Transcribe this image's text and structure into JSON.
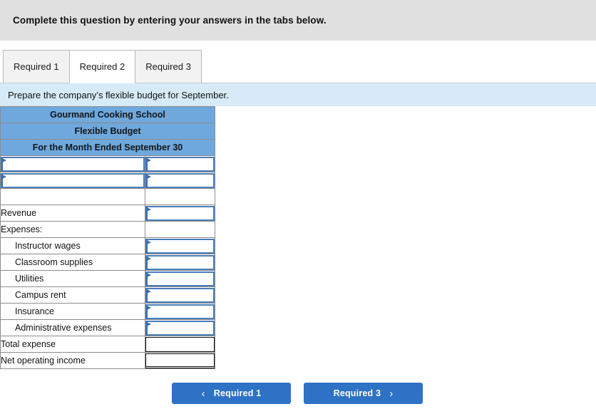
{
  "banner": {
    "text": "Complete this question by entering your answers in the tabs below."
  },
  "tabs": [
    {
      "label": "Required 1",
      "active": false
    },
    {
      "label": "Required 2",
      "active": true
    },
    {
      "label": "Required 3",
      "active": false
    }
  ],
  "subinstruction": {
    "text": "Prepare the company’s flexible budget for September."
  },
  "colors": {
    "banner_bg": "#e0e0e0",
    "subinstruction_bg": "#d6ebf7",
    "table_header_bg": "#6fa8dc",
    "input_border": "#4a7ebb",
    "button_bg": "#2d72c4",
    "grid_border": "#8c8c8c"
  },
  "worksheet": {
    "headers": [
      "Gourmand Cooking School",
      "Flexible Budget",
      "For the Month Ended September 30"
    ],
    "rows": [
      {
        "label": "",
        "label_kind": "input",
        "value": "",
        "value_kind": "input"
      },
      {
        "label": "",
        "label_kind": "input",
        "value": "",
        "value_kind": "input"
      },
      {
        "label": "",
        "label_kind": "blank",
        "value": "",
        "value_kind": "blank"
      },
      {
        "label": "Revenue",
        "label_kind": "text",
        "value": "",
        "value_kind": "input"
      },
      {
        "label": "Expenses:",
        "label_kind": "text",
        "value": "",
        "value_kind": "blank"
      },
      {
        "label": "Instructor wages",
        "label_kind": "indent",
        "value": "",
        "value_kind": "input"
      },
      {
        "label": "Classroom supplies",
        "label_kind": "indent",
        "value": "",
        "value_kind": "input"
      },
      {
        "label": "Utilities",
        "label_kind": "indent",
        "value": "",
        "value_kind": "input"
      },
      {
        "label": "Campus rent",
        "label_kind": "indent",
        "value": "",
        "value_kind": "input"
      },
      {
        "label": "Insurance",
        "label_kind": "indent",
        "value": "",
        "value_kind": "input"
      },
      {
        "label": "Administrative expenses",
        "label_kind": "indent",
        "value": "",
        "value_kind": "input"
      },
      {
        "label": "Total expense",
        "label_kind": "text",
        "value": "",
        "value_kind": "computed"
      },
      {
        "label": "Net operating income",
        "label_kind": "text",
        "value": "",
        "value_kind": "computed-total"
      }
    ]
  },
  "footer": {
    "prev": {
      "label": "Required 1",
      "icon": "chevron-left-icon",
      "glyph": "‹"
    },
    "next": {
      "label": "Required 3",
      "icon": "chevron-right-icon",
      "glyph": "›"
    }
  }
}
